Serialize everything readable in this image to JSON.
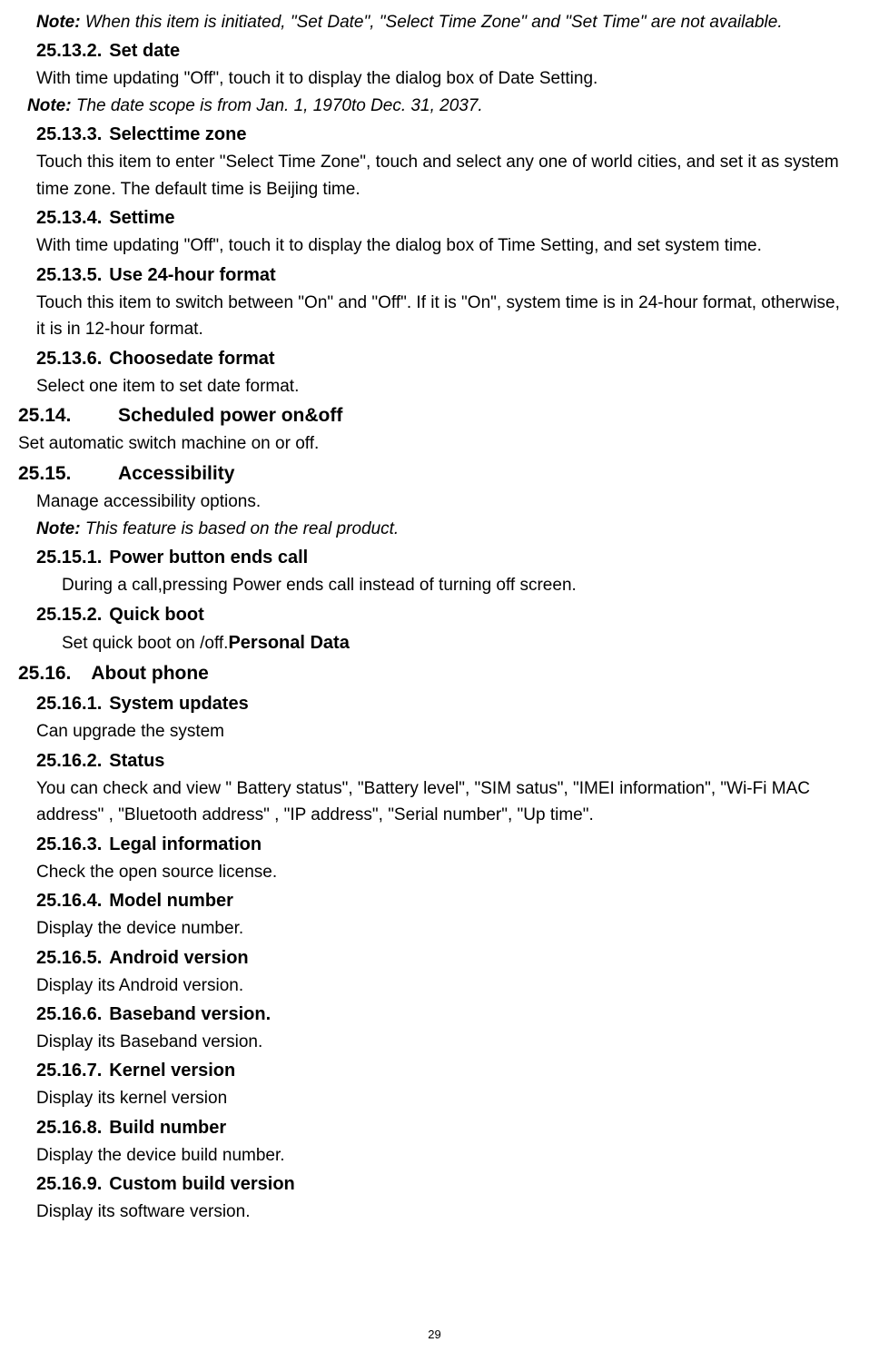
{
  "top_note": {
    "label": "Note:",
    "text": " When this item is initiated, \"Set Date\", \"Select Time Zone\" and \"Set Time\" are not available."
  },
  "s25_13_2": {
    "num": "25.13.2.",
    "title": "Set date",
    "body": "With time updating \"Off\", touch it to display the dialog box of Date Setting."
  },
  "s25_13_2_note": {
    "label": "Note:",
    "text": " The date scope is from Jan. 1, 1970to Dec. 31, 2037."
  },
  "s25_13_3": {
    "num": "25.13.3.",
    "title": "Selecttime zone",
    "body": "Touch this item to enter \"Select Time Zone\", touch and select any one of world cities, and set it as system time zone. The default time is Beijing time."
  },
  "s25_13_4": {
    "num": "25.13.4.",
    "title": "Settime",
    "body": "With time updating \"Off\", touch it to display the dialog box of Time Setting, and set system time."
  },
  "s25_13_5": {
    "num": "25.13.5.",
    "title": "Use 24-hour format",
    "body": "Touch this item to switch between \"On\" and \"Off\". If it is \"On\", system time is in 24-hour format, otherwise, it is in 12-hour format."
  },
  "s25_13_6": {
    "num": "25.13.6.",
    "title": "Choosedate format",
    "body": "Select one item to set date format."
  },
  "s25_14": {
    "num": "25.14.",
    "title": "Scheduled power on&off",
    "body": "Set automatic switch machine on or off."
  },
  "s25_15": {
    "num": "25.15.",
    "title": "Accessibility",
    "body": "Manage accessibility options."
  },
  "s25_15_note": {
    "label": "Note:",
    "text": " This feature is based on the real product."
  },
  "s25_15_1": {
    "num": "25.15.1.",
    "title": "Power button ends call",
    "body": "During a call,pressing Power ends call instead of turning off screen."
  },
  "s25_15_2": {
    "num": "25.15.2.",
    "title": "Quick boot",
    "body": "Set quick boot on /off.",
    "inline": "Personal Data"
  },
  "s25_16": {
    "num": "25.16.",
    "title": "About phone"
  },
  "s25_16_1": {
    "num": "25.16.1.",
    "title": "System updates",
    "body": "Can upgrade the system"
  },
  "s25_16_2": {
    "num": "25.16.2.",
    "title": "Status",
    "body": "You can check and view \" Battery status\", \"Battery level\", \"SIM satus\", \"IMEI information\", \"Wi-Fi MAC address\" , \"Bluetooth address\" , \"IP address\", \"Serial number\", \"Up time\"."
  },
  "s25_16_3": {
    "num": "25.16.3.",
    "title": "Legal information",
    "body": "Check the open source license."
  },
  "s25_16_4": {
    "num": "25.16.4.",
    "title": "Model number",
    "body": "Display the device number."
  },
  "s25_16_5": {
    "num": "25.16.5.",
    "title": "Android version",
    "body": "Display its Android version."
  },
  "s25_16_6": {
    "num": "25.16.6.",
    "title": "Baseband version.",
    "body": "Display its Baseband version."
  },
  "s25_16_7": {
    "num": "25.16.7.",
    "title": "Kernel version",
    "body": "Display its kernel version"
  },
  "s25_16_8": {
    "num": "25.16.8.",
    "title": "Build number",
    "body": "Display the device build number."
  },
  "s25_16_9": {
    "num": "25.16.9.",
    "title": "Custom build version",
    "body": "Display its software version."
  },
  "page_number": "29"
}
